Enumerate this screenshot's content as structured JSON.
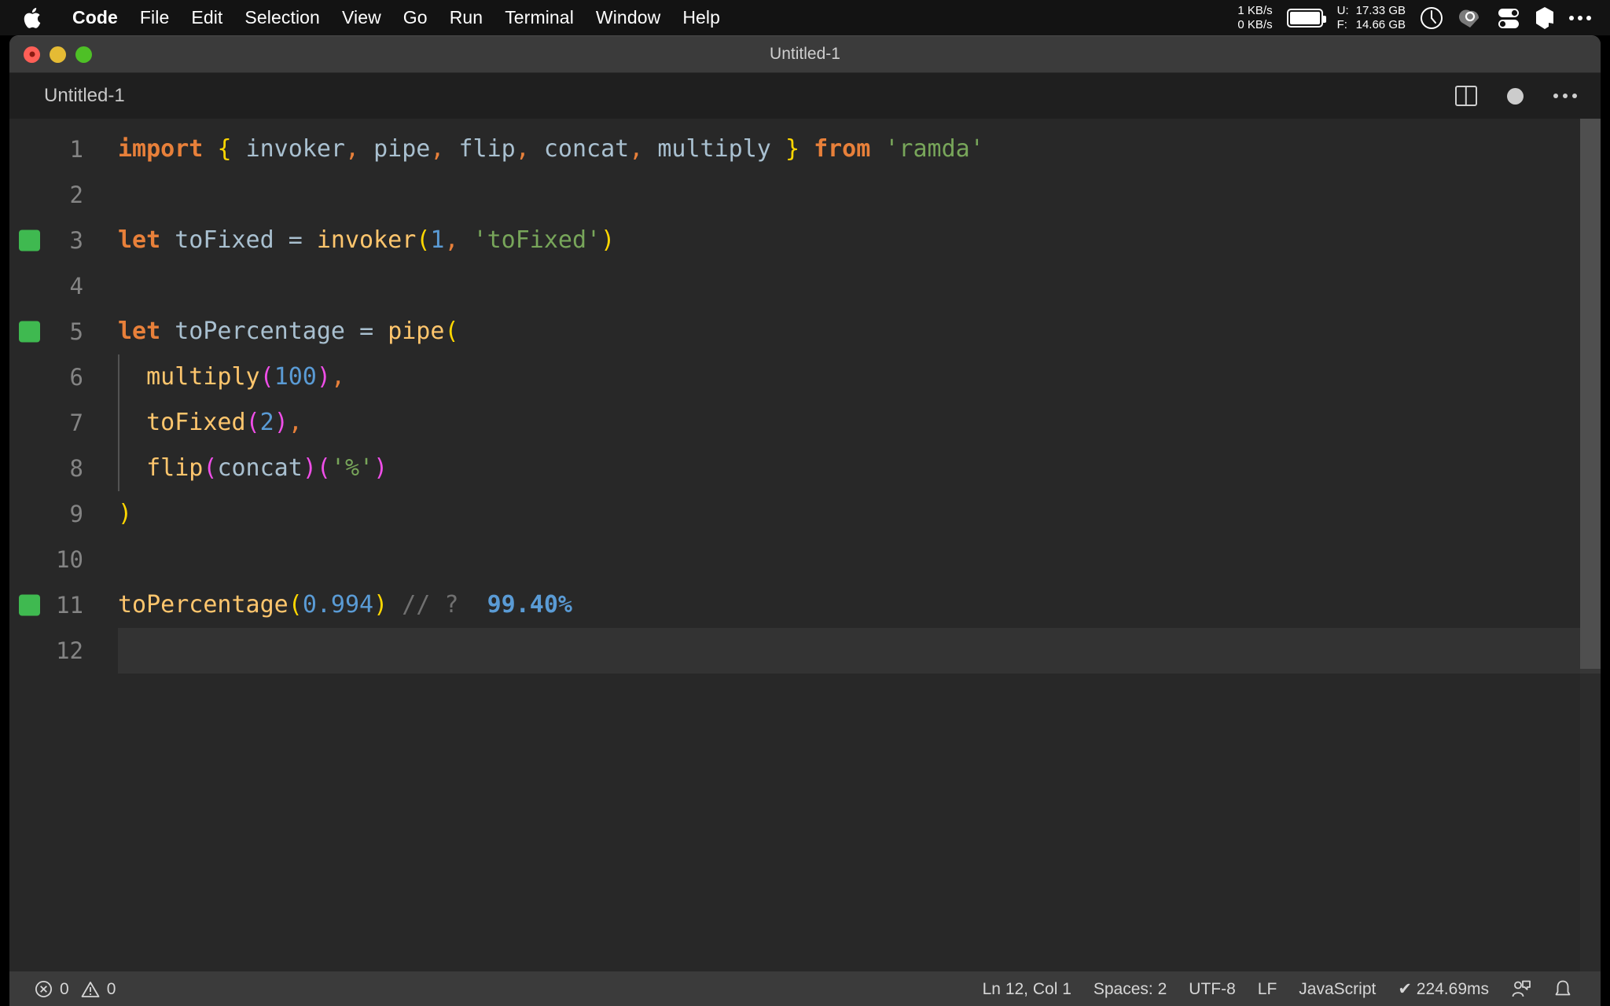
{
  "menubar": {
    "apple_icon": "apple-logo-icon",
    "items": [
      {
        "label": "Code",
        "bold": true
      },
      {
        "label": "File",
        "bold": false
      },
      {
        "label": "Edit",
        "bold": false
      },
      {
        "label": "Selection",
        "bold": false
      },
      {
        "label": "View",
        "bold": false
      },
      {
        "label": "Go",
        "bold": false
      },
      {
        "label": "Run",
        "bold": false
      },
      {
        "label": "Terminal",
        "bold": false
      },
      {
        "label": "Window",
        "bold": false
      },
      {
        "label": "Help",
        "bold": false
      }
    ],
    "network": {
      "upload": "1 KB/s",
      "download": "0 KB/s"
    },
    "battery_icon": "battery-icon",
    "disk": {
      "used_key": "U:",
      "used_value": "17.33 GB",
      "free_key": "F:",
      "free_value": "14.66 GB"
    },
    "status_icons": [
      "clock-icon",
      "cloud-sync-icon",
      "toggles-icon",
      "shape-icon",
      "more-icon"
    ]
  },
  "window": {
    "title": "Untitled-1",
    "traffic_lights": [
      "close-button",
      "minimize-button",
      "maximize-button"
    ]
  },
  "editor": {
    "tab_label": "Untitled-1",
    "actions": [
      "split-editor-icon",
      "unsaved-indicator",
      "more-actions-icon"
    ],
    "colors": {
      "background": "#282828",
      "keyword": "#e8803a",
      "identifier": "#a9c0d0",
      "function": "#ffc66d",
      "string": "#78a65a",
      "number": "#5a9bd5",
      "comment": "#707070",
      "bracket_1": "#ffd700",
      "bracket_2": "#ef4ee8",
      "result": "#5a9bd5",
      "gutter_marker": "#3fb950"
    },
    "lines": [
      {
        "no": "1",
        "marker": false,
        "active": false,
        "indent": false,
        "tokens": [
          {
            "t": "import",
            "c": "t-kw"
          },
          {
            "t": " ",
            "c": "t-ident"
          },
          {
            "t": "{",
            "c": "t-b1"
          },
          {
            "t": " ",
            "c": "t-ident"
          },
          {
            "t": "invoker",
            "c": "t-ident"
          },
          {
            "t": ",",
            "c": "t-punct"
          },
          {
            "t": " pipe",
            "c": "t-ident"
          },
          {
            "t": ",",
            "c": "t-punct"
          },
          {
            "t": " flip",
            "c": "t-ident"
          },
          {
            "t": ",",
            "c": "t-punct"
          },
          {
            "t": " concat",
            "c": "t-ident"
          },
          {
            "t": ",",
            "c": "t-punct"
          },
          {
            "t": " multiply",
            "c": "t-ident"
          },
          {
            "t": " ",
            "c": "t-ident"
          },
          {
            "t": "}",
            "c": "t-b1"
          },
          {
            "t": " ",
            "c": "t-ident"
          },
          {
            "t": "from",
            "c": "t-kw"
          },
          {
            "t": " ",
            "c": "t-ident"
          },
          {
            "t": "'ramda'",
            "c": "t-str"
          }
        ]
      },
      {
        "no": "2",
        "marker": false,
        "active": false,
        "indent": false,
        "tokens": []
      },
      {
        "no": "3",
        "marker": true,
        "active": false,
        "indent": false,
        "tokens": [
          {
            "t": "let",
            "c": "t-kw"
          },
          {
            "t": " toFixed ",
            "c": "t-ident"
          },
          {
            "t": "=",
            "c": "t-ident"
          },
          {
            "t": " ",
            "c": "t-ident"
          },
          {
            "t": "invoker",
            "c": "t-fn"
          },
          {
            "t": "(",
            "c": "t-b1"
          },
          {
            "t": "1",
            "c": "t-num"
          },
          {
            "t": ",",
            "c": "t-punct"
          },
          {
            "t": " ",
            "c": "t-ident"
          },
          {
            "t": "'toFixed'",
            "c": "t-str"
          },
          {
            "t": ")",
            "c": "t-b1"
          }
        ]
      },
      {
        "no": "4",
        "marker": false,
        "active": false,
        "indent": false,
        "tokens": []
      },
      {
        "no": "5",
        "marker": true,
        "active": false,
        "indent": false,
        "tokens": [
          {
            "t": "let",
            "c": "t-kw"
          },
          {
            "t": " toPercentage ",
            "c": "t-ident"
          },
          {
            "t": "=",
            "c": "t-ident"
          },
          {
            "t": " ",
            "c": "t-ident"
          },
          {
            "t": "pipe",
            "c": "t-fn"
          },
          {
            "t": "(",
            "c": "t-b1"
          }
        ]
      },
      {
        "no": "6",
        "marker": false,
        "active": false,
        "indent": true,
        "tokens": [
          {
            "t": "  ",
            "c": "t-ident"
          },
          {
            "t": "multiply",
            "c": "t-fn"
          },
          {
            "t": "(",
            "c": "t-b2"
          },
          {
            "t": "100",
            "c": "t-num"
          },
          {
            "t": ")",
            "c": "t-b2"
          },
          {
            "t": ",",
            "c": "t-punct"
          }
        ]
      },
      {
        "no": "7",
        "marker": false,
        "active": false,
        "indent": true,
        "tokens": [
          {
            "t": "  ",
            "c": "t-ident"
          },
          {
            "t": "toFixed",
            "c": "t-fn"
          },
          {
            "t": "(",
            "c": "t-b2"
          },
          {
            "t": "2",
            "c": "t-num"
          },
          {
            "t": ")",
            "c": "t-b2"
          },
          {
            "t": ",",
            "c": "t-punct"
          }
        ]
      },
      {
        "no": "8",
        "marker": false,
        "active": false,
        "indent": true,
        "tokens": [
          {
            "t": "  ",
            "c": "t-ident"
          },
          {
            "t": "flip",
            "c": "t-fn"
          },
          {
            "t": "(",
            "c": "t-b2"
          },
          {
            "t": "concat",
            "c": "t-ident"
          },
          {
            "t": ")",
            "c": "t-b2"
          },
          {
            "t": "(",
            "c": "t-b2"
          },
          {
            "t": "'%'",
            "c": "t-str"
          },
          {
            "t": ")",
            "c": "t-b2"
          }
        ]
      },
      {
        "no": "9",
        "marker": false,
        "active": false,
        "indent": false,
        "tokens": [
          {
            "t": ")",
            "c": "t-b1"
          }
        ]
      },
      {
        "no": "10",
        "marker": false,
        "active": false,
        "indent": false,
        "tokens": []
      },
      {
        "no": "11",
        "marker": true,
        "active": false,
        "indent": false,
        "tokens": [
          {
            "t": "toPercentage",
            "c": "t-fn"
          },
          {
            "t": "(",
            "c": "t-b1"
          },
          {
            "t": "0.994",
            "c": "t-num"
          },
          {
            "t": ")",
            "c": "t-b1"
          },
          {
            "t": " ",
            "c": "t-ident"
          },
          {
            "t": "// ?",
            "c": "t-comment"
          },
          {
            "t": "  ",
            "c": "t-ident"
          },
          {
            "t": "99.40%",
            "c": "t-result"
          }
        ]
      },
      {
        "no": "12",
        "marker": false,
        "active": true,
        "indent": false,
        "tokens": []
      }
    ]
  },
  "statusbar": {
    "errors_icon": "error-circle-icon",
    "errors": "0",
    "warnings_icon": "warning-triangle-icon",
    "warnings": "0",
    "cursor_position": "Ln 12, Col 1",
    "indentation": "Spaces: 2",
    "encoding": "UTF-8",
    "eol": "LF",
    "language": "JavaScript",
    "run_status": "✔ 224.69ms",
    "feedback_icon": "feedback-person-icon",
    "notifications_icon": "bell-icon"
  }
}
